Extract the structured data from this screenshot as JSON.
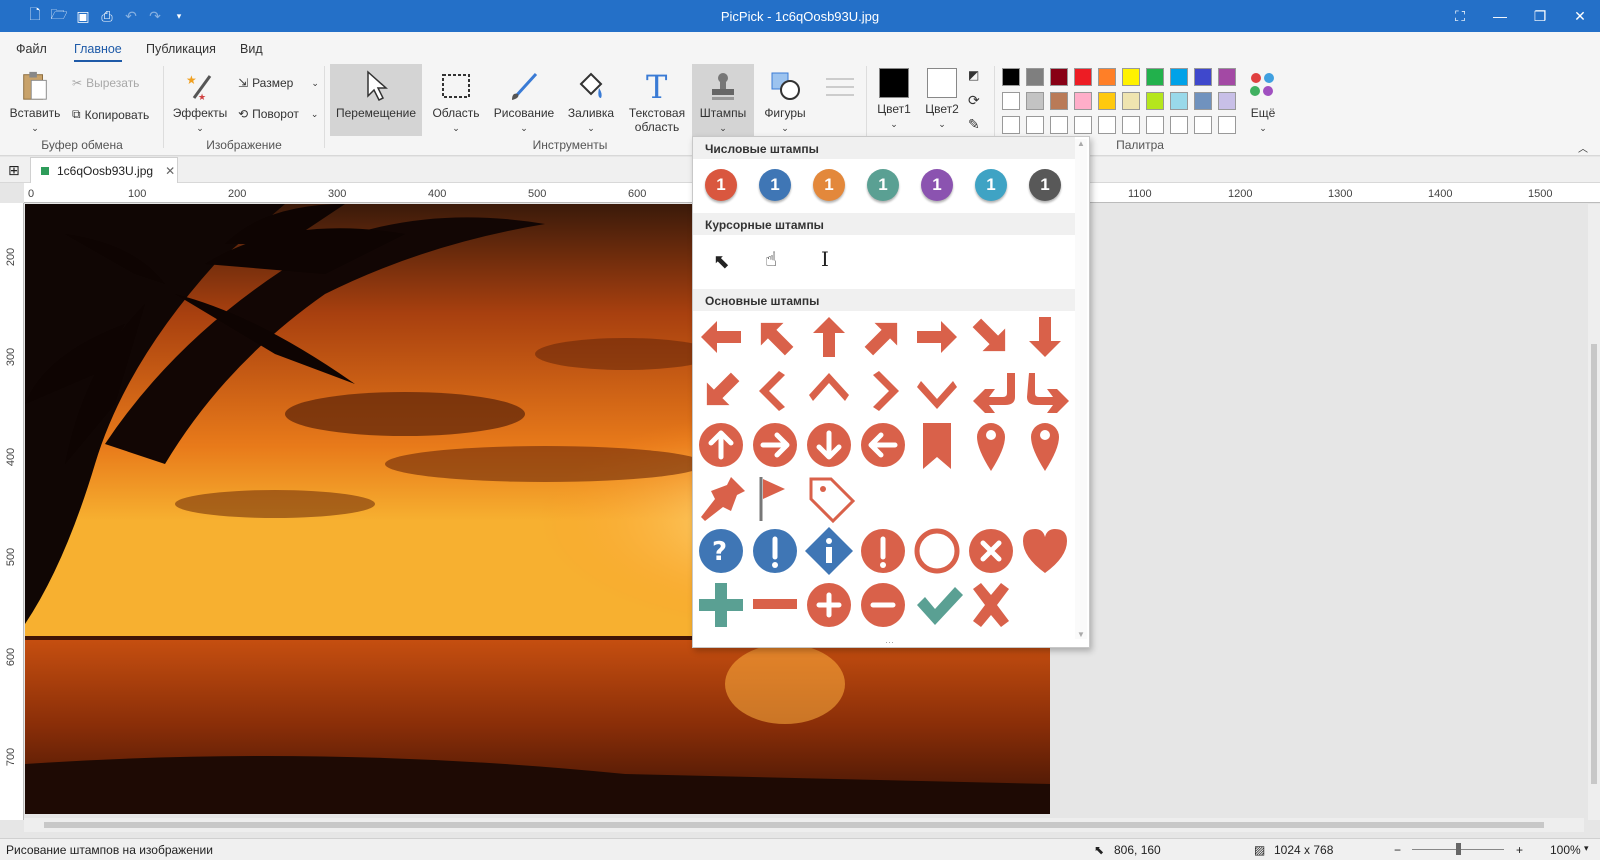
{
  "app": {
    "title": "PicPick - 1c6qOosb93U.jpg"
  },
  "quick_access": {
    "icons": [
      "new-file-icon",
      "open-folder-icon",
      "save-icon",
      "print-icon",
      "undo-icon",
      "redo-icon",
      "customize-icon"
    ]
  },
  "menu": {
    "file": "Файл",
    "home": "Главное",
    "publish": "Публикация",
    "view": "Вид"
  },
  "ribbon": {
    "paste": "Вставить",
    "cut": "Вырезать",
    "copy": "Копировать",
    "effects": "Эффекты",
    "resize": "Размер",
    "rotate": "Поворот",
    "move": "Перемещение",
    "region": "Область",
    "draw": "Рисование",
    "fill": "Заливка",
    "text_area_l1": "Текстовая",
    "text_area_l2": "область",
    "stamps": "Штампы",
    "shapes": "Фигуры",
    "color1": "Цвет1",
    "color2": "Цвет2",
    "more": "Ещё",
    "groups": {
      "clipboard": "Буфер обмена",
      "image": "Изображение",
      "tools": "Инструменты",
      "palette": "Палитра"
    }
  },
  "palette": {
    "row1": [
      "#000000",
      "#7f7f7f",
      "#880015",
      "#ed1c24",
      "#ff7f27",
      "#fff200",
      "#22b14c",
      "#00a2e8",
      "#3f48cc",
      "#a349a4"
    ],
    "row2": [
      "#ffffff",
      "#c3c3c3",
      "#b97a57",
      "#ffaec9",
      "#ffc90e",
      "#efe4b0",
      "#b5e61d",
      "#99d9ea",
      "#7092be",
      "#c8bfe7"
    ],
    "row3": [
      "#ffffff",
      "#ffffff",
      "#ffffff",
      "#ffffff",
      "#ffffff",
      "#ffffff",
      "#ffffff",
      "#ffffff",
      "#ffffff",
      "#ffffff"
    ]
  },
  "document": {
    "tab": "1c6qOosb93U.jpg"
  },
  "ruler": {
    "h_ticks": [
      "0",
      "100",
      "200",
      "300",
      "400",
      "500",
      "600",
      "1100",
      "1200",
      "1300",
      "1400",
      "1500"
    ],
    "v_ticks": [
      "200",
      "300",
      "400",
      "500",
      "600",
      "700"
    ]
  },
  "stamps_popup": {
    "numeric_header": "Числовые штампы",
    "cursor_header": "Курсорные штампы",
    "basic_header": "Основные штампы",
    "number_label": "1",
    "number_colors": [
      "#d9573f",
      "#3f76b5",
      "#e3883b",
      "#5aa093",
      "#8b53b0",
      "#3fa3c4",
      "#585858"
    ],
    "stamp_color": "#d9614a",
    "blue_color": "#3f76b5",
    "green_color": "#5aa093"
  },
  "status": {
    "hint": "Рисование штампов на изображении",
    "cursor_pos": "806, 160",
    "image_size": "1024 x 768",
    "zoom": "100%"
  }
}
